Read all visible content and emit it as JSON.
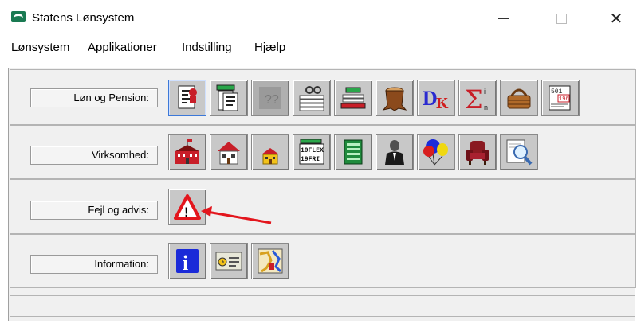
{
  "window": {
    "title": "Statens Lønsystem",
    "controls": {
      "minimize": "minimize",
      "maximize": "maximize",
      "close": "✕"
    }
  },
  "menu": {
    "items": [
      "Lønsystem",
      "Applikationer",
      "Indstilling",
      "Hjælp"
    ]
  },
  "groups": [
    {
      "label": "Løn og Pension:",
      "icons": [
        "employee-record-icon",
        "document-stack-icon",
        "question-doc-disabled-icon",
        "papers-glasses-icon",
        "book-stack-icon",
        "tree-stump-icon",
        "dk-letters-icon",
        "sum-sigma-icon",
        "basket-icon",
        "tax-form-icon"
      ]
    },
    {
      "label": "Virksomhed:",
      "icons": [
        "red-building-icon",
        "red-house-icon",
        "yellow-house-icon",
        "flex-fri-icon",
        "green-ledger-icon",
        "person-silhouette-icon",
        "balloons-icon",
        "armchair-icon",
        "magnifier-doc-icon"
      ]
    },
    {
      "label": "Fejl og advis:",
      "icons": [
        "warning-triangle-icon"
      ]
    },
    {
      "label": "Information:",
      "icons": [
        "info-icon",
        "id-card-clock-icon",
        "map-icon"
      ]
    }
  ],
  "icon_text": {
    "dk": "DK",
    "flex_top": "10FLEX",
    "flex_bottom": "19FRI",
    "tax_top": "501",
    "tax_mid": "196",
    "info": "i",
    "warn": "!",
    "sigma": "Σ",
    "sigma_sub": "n",
    "sigma_sup": "i"
  },
  "colors": {
    "annotation_arrow": "#e3161d",
    "selection": "#3c78d8"
  }
}
